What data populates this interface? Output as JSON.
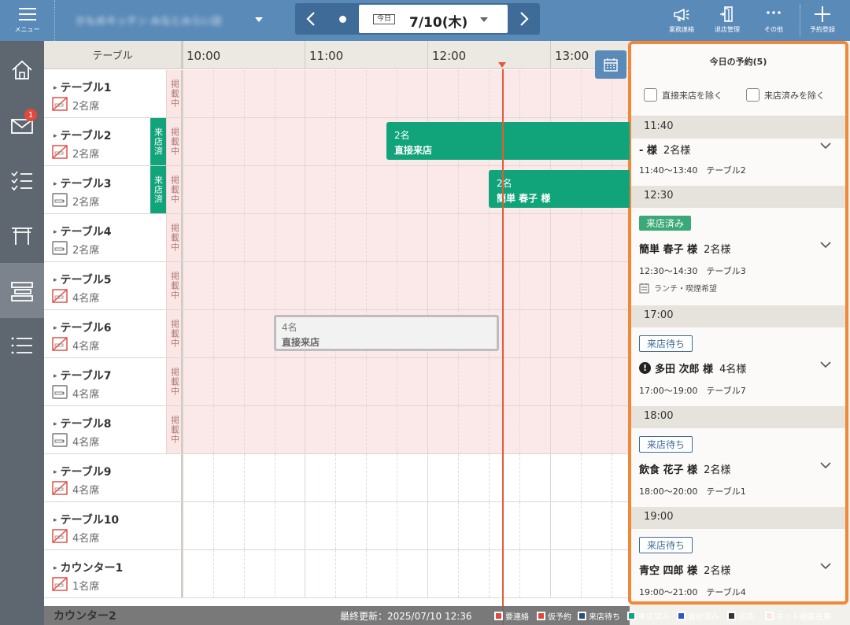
{
  "topbar": {
    "menu_label": "メニュー",
    "shop_name": "かもめキッチン みなとみらい店",
    "today_label": "今日",
    "date": "7/10(木)",
    "actions": [
      {
        "label": "業務連絡",
        "icon": "megaphone-icon"
      },
      {
        "label": "退店管理",
        "icon": "exit-door-icon"
      },
      {
        "label": "その他",
        "icon": "more-dots-icon"
      },
      {
        "label": "予約登録",
        "icon": "plus-icon"
      }
    ]
  },
  "sidebar": {
    "items": [
      {
        "name": "home",
        "icon": "home-icon"
      },
      {
        "name": "messages",
        "icon": "mail-icon",
        "badge": "1"
      },
      {
        "name": "tasks",
        "icon": "checklist-icon"
      },
      {
        "name": "shop",
        "icon": "gate-icon"
      },
      {
        "name": "seating",
        "icon": "table-layout-icon",
        "active": true
      },
      {
        "name": "list",
        "icon": "list-icon"
      }
    ]
  },
  "grid": {
    "table_header": "テーブル",
    "times": [
      "10:00",
      "11:00",
      "12:00",
      "13:00"
    ],
    "listed_label": "掲載中",
    "visited_label": "来店済",
    "rows": [
      {
        "name": "テーブル1",
        "seats": "2名席",
        "seat_icon": "no-smoking-icon",
        "listed": true,
        "visited": false
      },
      {
        "name": "テーブル2",
        "seats": "2名席",
        "seat_icon": "no-smoking-icon",
        "listed": true,
        "visited": true
      },
      {
        "name": "テーブル3",
        "seats": "2名席",
        "seat_icon": "smoking-icon",
        "listed": true,
        "visited": true
      },
      {
        "name": "テーブル4",
        "seats": "2名席",
        "seat_icon": "smoking-icon",
        "listed": true,
        "visited": false
      },
      {
        "name": "テーブル5",
        "seats": "4名席",
        "seat_icon": "no-smoking-icon",
        "listed": true,
        "visited": false
      },
      {
        "name": "テーブル6",
        "seats": "4名席",
        "seat_icon": "no-smoking-icon",
        "listed": true,
        "visited": false
      },
      {
        "name": "テーブル7",
        "seats": "4名席",
        "seat_icon": "smoking-icon",
        "listed": true,
        "visited": false
      },
      {
        "name": "テーブル8",
        "seats": "4名席",
        "seat_icon": "smoking-icon",
        "listed": true,
        "visited": false
      },
      {
        "name": "テーブル9",
        "seats": "4名席",
        "seat_icon": "no-smoking-icon",
        "listed": false,
        "visited": false
      },
      {
        "name": "テーブル10",
        "seats": "4名席",
        "seat_icon": "no-smoking-icon",
        "listed": false,
        "visited": false
      },
      {
        "name": "カウンター1",
        "seats": "1名席",
        "seat_icon": "no-smoking-icon",
        "listed": false,
        "visited": false
      }
    ],
    "peek_row": "カウンター2",
    "reservations": [
      {
        "count": "2名",
        "name": "直接来店",
        "style": "green"
      },
      {
        "count": "2名",
        "name": "簡単 春子 様",
        "style": "green"
      },
      {
        "count": "4名",
        "name": "直接来店",
        "style": "gray"
      }
    ]
  },
  "footer": {
    "last_updated": "最終更新：2025/07/10 12:36",
    "legend": [
      {
        "label": "要連絡",
        "color": "#e2483d"
      },
      {
        "label": "仮予約",
        "color": "#e2483d"
      },
      {
        "label": "来店待ち",
        "color": "#2c4f7a"
      },
      {
        "label": "来店済み",
        "color": "#11a37a"
      },
      {
        "label": "会計済み",
        "color": "#2d57c5"
      },
      {
        "label": "退店",
        "color": "#333333"
      },
      {
        "label": "ネット掲載在庫",
        "color": "#fbe6e6"
      }
    ]
  },
  "panel": {
    "title": "今日の予約(5)",
    "filter_direct": "直接来店を除く",
    "filter_visited": "来店済みを除く",
    "slots": [
      {
        "time": "11:40",
        "tag": "",
        "guest": "- 様",
        "party": "2名様",
        "alert": false,
        "when": "11:40～13:40　テーブル2",
        "note": ""
      },
      {
        "time": "12:30",
        "tag": "来店済み",
        "guest": "簡単 春子 様",
        "party": "2名様",
        "alert": false,
        "when": "12:30～14:30　テーブル3",
        "note": "ランチ・喫煙希望"
      },
      {
        "time": "17:00",
        "tag": "来店待ち",
        "guest": "多田 次郎 様",
        "party": "4名様",
        "alert": true,
        "when": "17:00～19:00　テーブル7",
        "note": ""
      },
      {
        "time": "18:00",
        "tag": "来店待ち",
        "guest": "飲食 花子 様",
        "party": "2名様",
        "alert": false,
        "when": "18:00～20:00　テーブル1",
        "note": ""
      },
      {
        "time": "19:00",
        "tag": "来店待ち",
        "guest": "青空 四郎 様",
        "party": "2名様",
        "alert": false,
        "when": "19:00～21:00　テーブル4",
        "note": ""
      }
    ]
  }
}
